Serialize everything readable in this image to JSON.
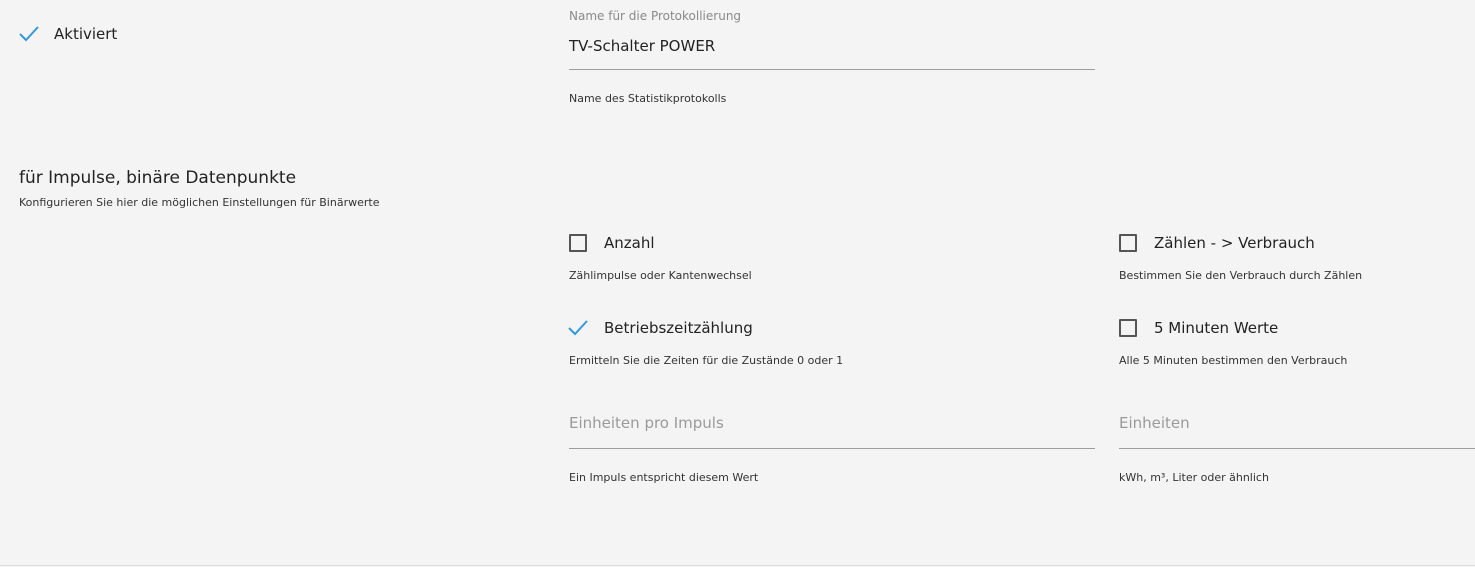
{
  "activated": {
    "label": "Aktiviert",
    "checked": true,
    "icon": "check-icon"
  },
  "log_name": {
    "label": "Name für die Protokollierung",
    "value": "TV-Schalter POWER",
    "help": "Name des Statistikprotokolls"
  },
  "section": {
    "title": "für Impulse, binäre Datenpunkte",
    "subtitle": "Konfigurieren Sie hier die möglichen Einstellungen für Binärwerte"
  },
  "options": {
    "count": {
      "label": "Anzahl",
      "help": "Zählimpulse oder Kantenwechsel",
      "checked": false
    },
    "count_consumption": {
      "label": "Zählen - > Verbrauch",
      "help": "Bestimmen Sie den Verbrauch durch Zählen",
      "checked": false
    },
    "runtime": {
      "label": "Betriebszeitzählung",
      "help": "Ermitteln Sie die Zeiten für die Zustände 0 oder 1",
      "checked": true
    },
    "five_min": {
      "label": "5 Minuten Werte",
      "help": "Alle 5 Minuten bestimmen den Verbrauch",
      "checked": false
    }
  },
  "fields": {
    "units_per_impulse": {
      "placeholder": "Einheiten pro Impuls",
      "help": "Ein Impuls entspricht diesem Wert"
    },
    "units": {
      "placeholder": "Einheiten",
      "help": "kWh, m³, Liter oder ähnlich"
    }
  },
  "colors": {
    "accent": "#3399dd",
    "background": "#f4f4f4"
  }
}
